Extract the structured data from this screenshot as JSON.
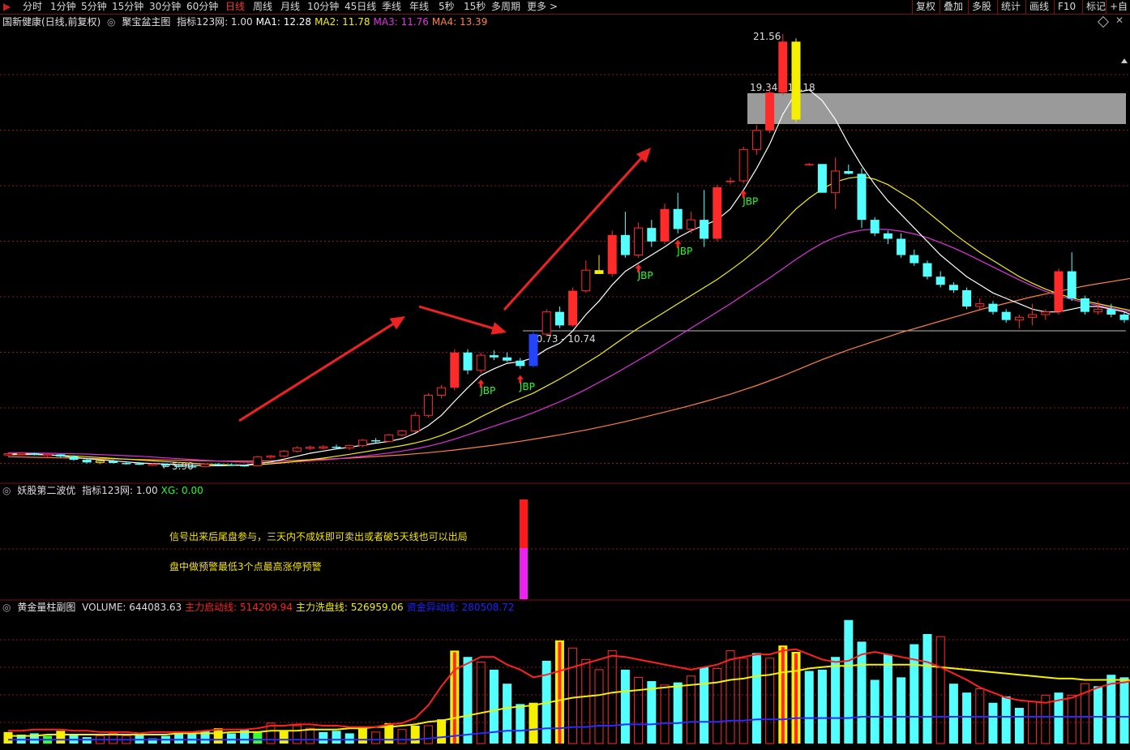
{
  "toolbar": {
    "tabs": [
      "分时",
      "1分钟",
      "5分钟",
      "15分钟",
      "30分钟",
      "60分钟",
      "日线",
      "周线",
      "月线",
      "10分钟",
      "45日线",
      "季线",
      "年线",
      "5秒",
      "15秒",
      "多周期",
      "更多 >"
    ],
    "active": "日线",
    "right": [
      "复权",
      "叠加",
      "多股",
      "统计",
      "画线",
      "F10",
      "标记",
      "+自"
    ]
  },
  "main_panel": {
    "stock": "国新健康(日线,前复权)",
    "template": "聚宝盆主图",
    "values": [
      {
        "label": "指标123网: 1.00",
        "color": "#dddddd"
      },
      {
        "label": "MA1: 12.28",
        "color": "#ffffff"
      },
      {
        "label": "MA2: 11.78",
        "color": "#f5f000"
      },
      {
        "label": "MA3: 11.76",
        "color": "#e030e0"
      },
      {
        "label": "MA4: 13.39",
        "color": "#ff8040"
      }
    ],
    "high_label": "21.56",
    "low_label": "5.90",
    "gap_label": "19.34 - 18.18",
    "support_label": "10.73 - 10.74",
    "signal": "JBP"
  },
  "panel2": {
    "title": "妖股第二波优",
    "values": [
      {
        "label": "指标123网: 1.00",
        "color": "#dddddd"
      },
      {
        "label": "XG: 0.00",
        "color": "#22ff22"
      }
    ],
    "note1": "信号出来后尾盘参与，三天内不成妖即可卖出或者破5天线也可以出局",
    "note2": "盘中做预警最低3个点最高涨停预警"
  },
  "panel3": {
    "title": "黄金量柱副图",
    "values": [
      {
        "label": "VOLUME: 644083.63",
        "color": "#dddddd"
      },
      {
        "label": "主力启动线: 514209.94",
        "color": "#ff2020"
      },
      {
        "label": "主力洗盘线: 526959.06",
        "color": "#f5f000"
      },
      {
        "label": "资金异动线: 280508.72",
        "color": "#2020ff"
      }
    ]
  },
  "colors": {
    "up": "#ff2a2a",
    "down": "#54ffff",
    "ma1": "#ffffff",
    "ma2": "#f5f000",
    "ma3": "#e030e0",
    "ma4": "#ff8040",
    "grid": "#8b1a1a"
  },
  "candles": [
    [
      6.05,
      6.1,
      5.98,
      6.06
    ],
    [
      6.06,
      6.12,
      6.0,
      6.08
    ],
    [
      6.08,
      6.1,
      6.0,
      6.02
    ],
    [
      6.02,
      6.06,
      5.95,
      6.04
    ],
    [
      6.04,
      6.06,
      5.92,
      5.96
    ],
    [
      5.96,
      6.0,
      5.8,
      5.84
    ],
    [
      5.84,
      5.88,
      5.7,
      5.74
    ],
    [
      5.74,
      5.82,
      5.68,
      5.8
    ],
    [
      5.8,
      5.84,
      5.7,
      5.72
    ],
    [
      5.72,
      5.76,
      5.66,
      5.7
    ],
    [
      5.7,
      5.76,
      5.64,
      5.66
    ],
    [
      5.66,
      5.72,
      5.62,
      5.68
    ],
    [
      5.68,
      5.7,
      5.6,
      5.62
    ],
    [
      5.62,
      5.66,
      5.55,
      5.6
    ],
    [
      5.6,
      5.64,
      5.56,
      5.58
    ],
    [
      5.58,
      5.7,
      5.56,
      5.68
    ],
    [
      5.68,
      5.72,
      5.62,
      5.66
    ],
    [
      5.66,
      5.7,
      5.62,
      5.64
    ],
    [
      5.64,
      5.66,
      5.58,
      5.62
    ],
    [
      5.62,
      5.98,
      5.6,
      5.94
    ],
    [
      5.94,
      6.02,
      5.88,
      5.98
    ],
    [
      5.98,
      6.2,
      5.94,
      6.16
    ],
    [
      6.16,
      6.34,
      6.1,
      6.28
    ],
    [
      6.28,
      6.36,
      6.2,
      6.3
    ],
    [
      6.3,
      6.38,
      6.22,
      6.32
    ],
    [
      6.32,
      6.4,
      6.24,
      6.28
    ],
    [
      6.28,
      6.4,
      6.2,
      6.36
    ],
    [
      6.36,
      6.6,
      6.3,
      6.56
    ],
    [
      6.56,
      6.64,
      6.46,
      6.52
    ],
    [
      6.52,
      6.8,
      6.48,
      6.76
    ],
    [
      6.76,
      6.94,
      6.7,
      6.9
    ],
    [
      6.9,
      7.6,
      6.84,
      7.48
    ],
    [
      7.48,
      8.3,
      7.4,
      8.22
    ],
    [
      8.22,
      8.6,
      8.1,
      8.5
    ],
    [
      8.5,
      9.92,
      8.4,
      9.8
    ],
    [
      9.8,
      9.92,
      9.0,
      9.14
    ],
    [
      9.14,
      9.8,
      9.04,
      9.7
    ],
    [
      9.7,
      9.88,
      9.52,
      9.62
    ],
    [
      9.62,
      9.8,
      9.45,
      9.5
    ],
    [
      9.5,
      9.6,
      9.2,
      9.3
    ],
    [
      9.3,
      10.6,
      9.25,
      10.48
    ],
    [
      10.48,
      11.4,
      10.4,
      11.3
    ],
    [
      11.3,
      11.5,
      10.7,
      10.8
    ],
    [
      10.8,
      12.2,
      10.75,
      12.08
    ],
    [
      12.08,
      13.2,
      12.0,
      12.84
    ],
    [
      12.84,
      13.4,
      12.7,
      12.7
    ],
    [
      12.7,
      14.3,
      12.6,
      14.14
    ],
    [
      14.14,
      15.0,
      13.3,
      13.4
    ],
    [
      13.4,
      14.6,
      13.3,
      14.4
    ],
    [
      14.4,
      14.7,
      13.7,
      13.9
    ],
    [
      13.9,
      15.3,
      13.8,
      15.1
    ],
    [
      15.1,
      15.7,
      14.2,
      14.36
    ],
    [
      14.36,
      15.0,
      14.2,
      14.7
    ],
    [
      14.7,
      15.8,
      13.7,
      14.0
    ],
    [
      14.0,
      16.0,
      13.9,
      15.9
    ],
    [
      16.14,
      16.26,
      16.02,
      16.14
    ],
    [
      16.14,
      17.4,
      16.04,
      17.3
    ],
    [
      17.3,
      18.2,
      17.1,
      18.0
    ],
    [
      18.0,
      19.6,
      17.9,
      19.4
    ],
    [
      19.4,
      21.56,
      19.3,
      21.28
    ],
    [
      21.28,
      21.4,
      18.3,
      18.4
    ],
    [
      16.76,
      16.8,
      16.7,
      16.76
    ],
    [
      16.76,
      16.76,
      15.7,
      15.7
    ],
    [
      15.7,
      17.0,
      15.1,
      16.5
    ],
    [
      16.5,
      16.74,
      16.38,
      16.4
    ],
    [
      16.4,
      16.6,
      14.4,
      14.7
    ],
    [
      14.7,
      14.8,
      14.1,
      14.2
    ],
    [
      14.2,
      14.3,
      13.8,
      14.0
    ],
    [
      14.0,
      14.2,
      13.3,
      13.4
    ],
    [
      13.4,
      13.6,
      13.0,
      13.1
    ],
    [
      13.1,
      13.2,
      12.5,
      12.6
    ],
    [
      12.6,
      12.8,
      12.2,
      12.3
    ],
    [
      12.3,
      12.4,
      12.0,
      12.1
    ],
    [
      12.1,
      12.2,
      11.4,
      11.5
    ],
    [
      11.5,
      11.8,
      11.4,
      11.6
    ],
    [
      11.6,
      11.7,
      11.2,
      11.3
    ],
    [
      11.3,
      11.4,
      10.9,
      11.0
    ],
    [
      11.0,
      11.2,
      10.7,
      11.1
    ],
    [
      11.1,
      11.6,
      10.8,
      11.2
    ],
    [
      11.2,
      11.4,
      11.0,
      11.3
    ],
    [
      11.3,
      12.9,
      11.2,
      12.8
    ],
    [
      12.8,
      13.5,
      11.7,
      11.8
    ],
    [
      11.8,
      11.9,
      11.2,
      11.3
    ],
    [
      11.3,
      11.7,
      11.2,
      11.4
    ],
    [
      11.4,
      11.6,
      11.1,
      11.2
    ],
    [
      11.2,
      11.3,
      10.9,
      11.0
    ],
    [
      11.0,
      11.1,
      10.8,
      10.86
    ],
    [
      10.86,
      11.1,
      10.7,
      11.0
    ],
    [
      11.0,
      11.1,
      10.9,
      11.0
    ],
    [
      11.0,
      11.1,
      10.9,
      11.0
    ],
    [
      11.0,
      12.0,
      10.95,
      11.9
    ],
    [
      11.9,
      12.5,
      11.8,
      12.4
    ],
    [
      12.4,
      12.8,
      12.0,
      12.5
    ],
    [
      12.5,
      12.8,
      12.2,
      12.6
    ],
    [
      12.6,
      13.1,
      12.4,
      12.2
    ]
  ],
  "ma1": [
    6.05,
    6.06,
    6.05,
    6.03,
    5.98,
    5.93,
    5.88,
    5.84,
    5.8,
    5.76,
    5.72,
    5.7,
    5.68,
    5.66,
    5.64,
    5.62,
    5.62,
    5.63,
    5.64,
    5.7,
    5.76,
    5.86,
    5.97,
    6.08,
    6.16,
    6.24,
    6.3,
    6.38,
    6.45,
    6.52,
    6.62,
    6.82,
    7.1,
    7.48,
    8.0,
    8.5,
    8.96,
    9.2,
    9.4,
    9.46,
    9.6,
    9.92,
    10.14,
    10.6,
    11.2,
    11.7,
    12.3,
    12.8,
    13.1,
    13.4,
    13.7,
    14.04,
    14.3,
    14.5,
    14.7,
    15.1,
    15.8,
    16.6,
    17.5,
    18.6,
    19.4,
    19.5,
    19.1,
    18.4,
    17.5,
    16.7,
    16.0,
    15.4,
    14.9,
    14.4,
    13.9,
    13.4,
    13.0,
    12.6,
    12.3,
    12.0,
    11.8,
    11.6,
    11.4,
    11.3,
    11.3,
    11.4,
    11.5,
    11.5,
    11.4,
    11.3,
    11.1,
    11.0,
    11.0,
    11.0,
    11.1,
    11.3,
    11.6,
    11.9,
    12.1
  ],
  "ma2": [
    6.02,
    6.03,
    6.03,
    6.02,
    6.0,
    5.98,
    5.95,
    5.92,
    5.89,
    5.86,
    5.83,
    5.8,
    5.77,
    5.74,
    5.71,
    5.68,
    5.66,
    5.65,
    5.64,
    5.66,
    5.69,
    5.73,
    5.78,
    5.84,
    5.9,
    5.97,
    6.04,
    6.12,
    6.2,
    6.28,
    6.36,
    6.46,
    6.58,
    6.74,
    6.94,
    7.16,
    7.42,
    7.66,
    7.9,
    8.1,
    8.3,
    8.56,
    8.82,
    9.1,
    9.4,
    9.7,
    10.04,
    10.38,
    10.7,
    11.0,
    11.3,
    11.6,
    11.9,
    12.2,
    12.5,
    12.84,
    13.2,
    13.6,
    14.06,
    14.6,
    15.1,
    15.5,
    15.84,
    16.1,
    16.24,
    16.3,
    16.2,
    16.0,
    15.7,
    15.4,
    15.0,
    14.6,
    14.2,
    13.84,
    13.5,
    13.2,
    12.9,
    12.6,
    12.36,
    12.14,
    11.96,
    11.82,
    11.7,
    11.6,
    11.5,
    11.4,
    11.3,
    11.24,
    11.2,
    11.16,
    11.16,
    11.2,
    11.3,
    11.44,
    11.6
  ],
  "ma3": [
    6.1,
    6.1,
    6.09,
    6.08,
    6.07,
    6.06,
    6.05,
    6.03,
    6.01,
    5.99,
    5.97,
    5.94,
    5.91,
    5.88,
    5.85,
    5.82,
    5.79,
    5.77,
    5.75,
    5.74,
    5.74,
    5.75,
    5.77,
    5.8,
    5.83,
    5.87,
    5.92,
    5.97,
    6.03,
    6.09,
    6.16,
    6.24,
    6.34,
    6.46,
    6.6,
    6.76,
    6.92,
    7.08,
    7.24,
    7.4,
    7.58,
    7.78,
    7.98,
    8.2,
    8.44,
    8.7,
    8.96,
    9.24,
    9.52,
    9.8,
    10.1,
    10.4,
    10.7,
    11.0,
    11.3,
    11.6,
    11.92,
    12.24,
    12.56,
    12.9,
    13.24,
    13.56,
    13.84,
    14.06,
    14.22,
    14.32,
    14.36,
    14.34,
    14.28,
    14.18,
    14.04,
    13.86,
    13.66,
    13.44,
    13.2,
    12.96,
    12.72,
    12.48,
    12.26,
    12.06,
    11.9,
    11.76,
    11.64,
    11.54,
    11.44,
    11.34,
    11.24,
    11.16,
    11.1,
    11.06,
    11.06,
    11.1,
    11.2,
    11.34,
    11.5
  ],
  "ma4": [
    5.95,
    5.94,
    5.93,
    5.92,
    5.91,
    5.9,
    5.89,
    5.88,
    5.87,
    5.86,
    5.85,
    5.84,
    5.83,
    5.82,
    5.81,
    5.8,
    5.79,
    5.79,
    5.79,
    5.79,
    5.8,
    5.81,
    5.82,
    5.84,
    5.86,
    5.88,
    5.9,
    5.93,
    5.96,
    5.99,
    6.02,
    6.06,
    6.1,
    6.15,
    6.2,
    6.26,
    6.32,
    6.38,
    6.45,
    6.52,
    6.6,
    6.68,
    6.76,
    6.85,
    6.94,
    7.04,
    7.14,
    7.25,
    7.36,
    7.48,
    7.6,
    7.72,
    7.85,
    7.98,
    8.12,
    8.26,
    8.42,
    8.58,
    8.76,
    8.94,
    9.14,
    9.34,
    9.54,
    9.72,
    9.9,
    10.06,
    10.22,
    10.38,
    10.54,
    10.68,
    10.82,
    10.96,
    11.1,
    11.24,
    11.38,
    11.5,
    11.62,
    11.74,
    11.86,
    11.96,
    12.06,
    12.16,
    12.26,
    12.34,
    12.42,
    12.5,
    12.58,
    12.64,
    12.7,
    12.76,
    12.8,
    12.86,
    12.92,
    12.98,
    13.04
  ],
  "jbp_signals": [
    36,
    39,
    48,
    51,
    56,
    94
  ],
  "volume": [
    9,
    7,
    8,
    6,
    10,
    7,
    5,
    6,
    8,
    6,
    7,
    4,
    6,
    9,
    8,
    10,
    12,
    8,
    11,
    9,
    16,
    10,
    14,
    12,
    9,
    10,
    8,
    12,
    9,
    16,
    11,
    14,
    14,
    19,
    73,
    68,
    64,
    58,
    47,
    31,
    32,
    65,
    81,
    75,
    66,
    58,
    73,
    58,
    52,
    49,
    46,
    48,
    53,
    60,
    59,
    73,
    67,
    71,
    67,
    77,
    72,
    57,
    58,
    68,
    97,
    80,
    50,
    70,
    52,
    78,
    86,
    84,
    47,
    40,
    43,
    32,
    37,
    28,
    33,
    38,
    40,
    38,
    47,
    45,
    54,
    52,
    64,
    84,
    83,
    67,
    49,
    42,
    35,
    37,
    42
  ],
  "vol_colors": [
    "yel",
    "cyan",
    "cyan",
    "grn",
    "yel",
    "cyan",
    "cyan",
    "red",
    "red",
    "red",
    "cyan",
    "cyan",
    "cyan",
    "cyan",
    "cyan",
    "cyan",
    "yel",
    "cyan",
    "cyan",
    "grn",
    "red",
    "yel",
    "red",
    "red",
    "cyan",
    "cyan",
    "cyan",
    "yel",
    "red",
    "yel",
    "red",
    "yel",
    "red",
    "yel",
    "yel",
    "cyan",
    "red",
    "cyan",
    "cyan",
    "cyan",
    "yel",
    "cyan",
    "yel",
    "red",
    "red",
    "red",
    "red",
    "cyan",
    "red",
    "cyan",
    "red",
    "cyan",
    "red",
    "cyan",
    "red",
    "red",
    "red",
    "cyan",
    "red",
    "yel",
    "yel",
    "cyan",
    "cyan",
    "cyan",
    "cyan",
    "cyan",
    "cyan",
    "cyan",
    "cyan",
    "cyan",
    "cyan",
    "red",
    "cyan",
    "cyan",
    "red",
    "cyan",
    "cyan",
    "cyan",
    "red",
    "red",
    "cyan",
    "red",
    "red",
    "cyan",
    "cyan",
    "cyan",
    "cyan",
    "red",
    "red",
    "cyan",
    "cyan",
    "red",
    "grn",
    "red",
    "red"
  ],
  "vol_red_line": [
    10,
    10,
    11,
    11,
    11,
    10,
    10,
    9,
    9,
    9,
    8,
    9,
    9,
    9,
    9,
    10,
    11,
    11,
    11,
    12,
    14,
    14,
    15,
    15,
    14,
    14,
    13,
    13,
    13,
    15,
    16,
    20,
    30,
    45,
    58,
    63,
    68,
    68,
    62,
    58,
    52,
    54,
    57,
    60,
    63,
    66,
    69,
    68,
    66,
    64,
    62,
    60,
    58,
    60,
    62,
    66,
    68,
    70,
    70,
    73,
    74,
    70,
    66,
    64,
    65,
    70,
    72,
    70,
    68,
    66,
    64,
    60,
    55,
    50,
    44,
    40,
    36,
    34,
    33,
    32,
    34,
    36,
    40,
    44,
    47,
    48,
    50,
    54,
    60,
    62,
    60,
    55,
    50,
    46,
    44
  ],
  "vol_yel_line": [
    6,
    6,
    6,
    7,
    7,
    7,
    7,
    7,
    7,
    7,
    7,
    7,
    7,
    8,
    8,
    8,
    8,
    9,
    9,
    9,
    10,
    10,
    10,
    11,
    11,
    11,
    12,
    12,
    13,
    13,
    14,
    15,
    17,
    18,
    20,
    22,
    24,
    26,
    28,
    29,
    30,
    32,
    34,
    36,
    37,
    38,
    40,
    41,
    42,
    43,
    44,
    45,
    46,
    47,
    48,
    50,
    51,
    53,
    54,
    56,
    57,
    59,
    60,
    61,
    61,
    62,
    62,
    62,
    62,
    62,
    61,
    60,
    59,
    58,
    57,
    56,
    55,
    54,
    53,
    52,
    51,
    51,
    50,
    50,
    50,
    50,
    49,
    48,
    48,
    47,
    47,
    47,
    47,
    47,
    47
  ],
  "vol_blu_line": [
    3,
    3,
    3,
    3,
    3,
    3,
    3,
    3,
    3,
    3,
    3,
    3,
    3,
    3,
    3,
    3,
    3,
    3,
    3,
    3,
    3,
    3,
    3,
    3,
    3,
    3,
    3,
    3,
    3,
    3,
    3,
    3,
    4,
    5,
    6,
    7,
    8,
    9,
    10,
    10,
    11,
    12,
    12,
    13,
    13,
    14,
    14,
    15,
    15,
    15,
    16,
    16,
    17,
    17,
    17,
    18,
    18,
    19,
    19,
    19,
    20,
    20,
    20,
    20,
    20,
    21,
    21,
    21,
    21,
    21,
    21,
    21,
    21,
    21,
    21,
    21,
    21,
    21,
    21,
    21,
    21,
    21,
    21,
    21,
    21,
    21,
    21,
    21,
    21,
    21,
    21,
    21,
    21,
    21,
    21
  ]
}
